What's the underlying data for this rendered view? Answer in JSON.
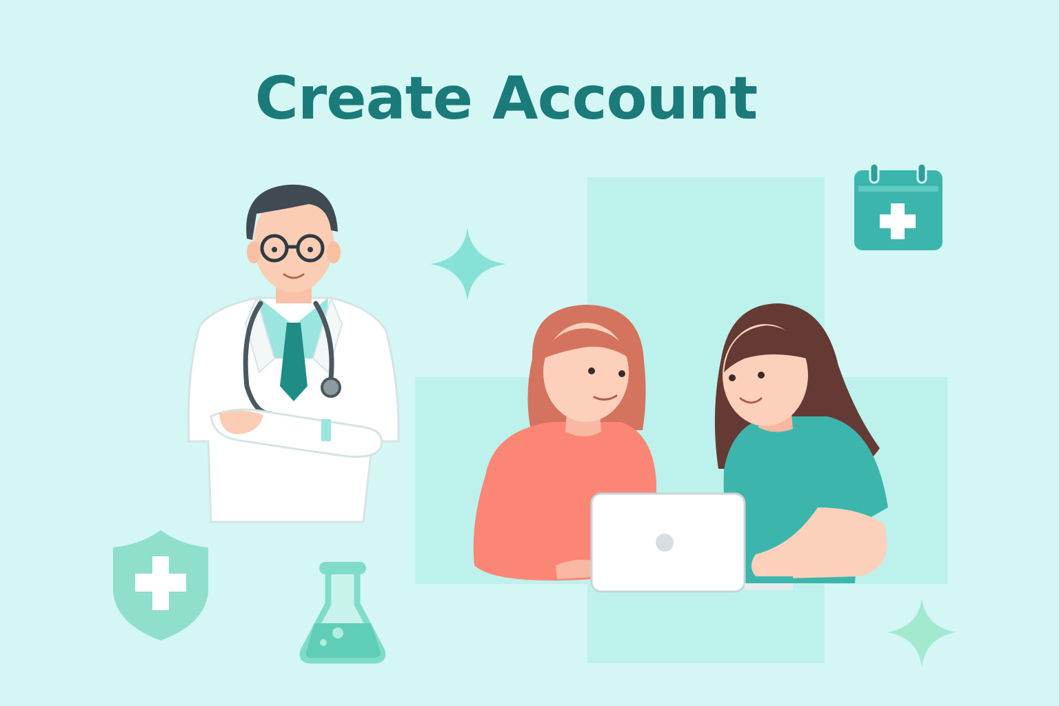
{
  "page": {
    "title": "Create Account",
    "background_color": "#d4f6f4",
    "accent_color": "#1b7a7a"
  },
  "illustration": {
    "figures": [
      "doctor",
      "woman-red-hair",
      "woman-brown-hair"
    ],
    "icons": [
      "medical-calendar-icon",
      "shield-cross-icon",
      "lab-flask-icon",
      "sparkle-icon",
      "laptop-icon"
    ]
  }
}
